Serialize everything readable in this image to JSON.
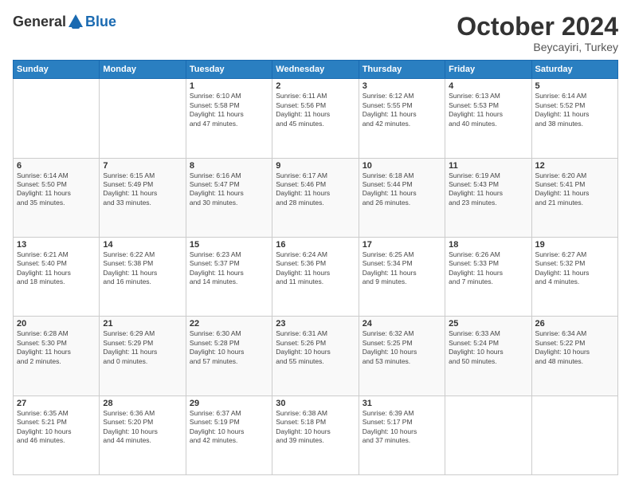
{
  "header": {
    "logo": {
      "line1": "General",
      "line2": "Blue"
    },
    "title": "October 2024",
    "location": "Beycayiri, Turkey"
  },
  "days_of_week": [
    "Sunday",
    "Monday",
    "Tuesday",
    "Wednesday",
    "Thursday",
    "Friday",
    "Saturday"
  ],
  "weeks": [
    {
      "row_class": "row-odd",
      "cells": [
        {
          "day": "",
          "info": ""
        },
        {
          "day": "",
          "info": ""
        },
        {
          "day": "1",
          "info": "Sunrise: 6:10 AM\nSunset: 5:58 PM\nDaylight: 11 hours\nand 47 minutes."
        },
        {
          "day": "2",
          "info": "Sunrise: 6:11 AM\nSunset: 5:56 PM\nDaylight: 11 hours\nand 45 minutes."
        },
        {
          "day": "3",
          "info": "Sunrise: 6:12 AM\nSunset: 5:55 PM\nDaylight: 11 hours\nand 42 minutes."
        },
        {
          "day": "4",
          "info": "Sunrise: 6:13 AM\nSunset: 5:53 PM\nDaylight: 11 hours\nand 40 minutes."
        },
        {
          "day": "5",
          "info": "Sunrise: 6:14 AM\nSunset: 5:52 PM\nDaylight: 11 hours\nand 38 minutes."
        }
      ]
    },
    {
      "row_class": "row-even",
      "cells": [
        {
          "day": "6",
          "info": "Sunrise: 6:14 AM\nSunset: 5:50 PM\nDaylight: 11 hours\nand 35 minutes."
        },
        {
          "day": "7",
          "info": "Sunrise: 6:15 AM\nSunset: 5:49 PM\nDaylight: 11 hours\nand 33 minutes."
        },
        {
          "day": "8",
          "info": "Sunrise: 6:16 AM\nSunset: 5:47 PM\nDaylight: 11 hours\nand 30 minutes."
        },
        {
          "day": "9",
          "info": "Sunrise: 6:17 AM\nSunset: 5:46 PM\nDaylight: 11 hours\nand 28 minutes."
        },
        {
          "day": "10",
          "info": "Sunrise: 6:18 AM\nSunset: 5:44 PM\nDaylight: 11 hours\nand 26 minutes."
        },
        {
          "day": "11",
          "info": "Sunrise: 6:19 AM\nSunset: 5:43 PM\nDaylight: 11 hours\nand 23 minutes."
        },
        {
          "day": "12",
          "info": "Sunrise: 6:20 AM\nSunset: 5:41 PM\nDaylight: 11 hours\nand 21 minutes."
        }
      ]
    },
    {
      "row_class": "row-odd",
      "cells": [
        {
          "day": "13",
          "info": "Sunrise: 6:21 AM\nSunset: 5:40 PM\nDaylight: 11 hours\nand 18 minutes."
        },
        {
          "day": "14",
          "info": "Sunrise: 6:22 AM\nSunset: 5:38 PM\nDaylight: 11 hours\nand 16 minutes."
        },
        {
          "day": "15",
          "info": "Sunrise: 6:23 AM\nSunset: 5:37 PM\nDaylight: 11 hours\nand 14 minutes."
        },
        {
          "day": "16",
          "info": "Sunrise: 6:24 AM\nSunset: 5:36 PM\nDaylight: 11 hours\nand 11 minutes."
        },
        {
          "day": "17",
          "info": "Sunrise: 6:25 AM\nSunset: 5:34 PM\nDaylight: 11 hours\nand 9 minutes."
        },
        {
          "day": "18",
          "info": "Sunrise: 6:26 AM\nSunset: 5:33 PM\nDaylight: 11 hours\nand 7 minutes."
        },
        {
          "day": "19",
          "info": "Sunrise: 6:27 AM\nSunset: 5:32 PM\nDaylight: 11 hours\nand 4 minutes."
        }
      ]
    },
    {
      "row_class": "row-even",
      "cells": [
        {
          "day": "20",
          "info": "Sunrise: 6:28 AM\nSunset: 5:30 PM\nDaylight: 11 hours\nand 2 minutes."
        },
        {
          "day": "21",
          "info": "Sunrise: 6:29 AM\nSunset: 5:29 PM\nDaylight: 11 hours\nand 0 minutes."
        },
        {
          "day": "22",
          "info": "Sunrise: 6:30 AM\nSunset: 5:28 PM\nDaylight: 10 hours\nand 57 minutes."
        },
        {
          "day": "23",
          "info": "Sunrise: 6:31 AM\nSunset: 5:26 PM\nDaylight: 10 hours\nand 55 minutes."
        },
        {
          "day": "24",
          "info": "Sunrise: 6:32 AM\nSunset: 5:25 PM\nDaylight: 10 hours\nand 53 minutes."
        },
        {
          "day": "25",
          "info": "Sunrise: 6:33 AM\nSunset: 5:24 PM\nDaylight: 10 hours\nand 50 minutes."
        },
        {
          "day": "26",
          "info": "Sunrise: 6:34 AM\nSunset: 5:22 PM\nDaylight: 10 hours\nand 48 minutes."
        }
      ]
    },
    {
      "row_class": "row-odd",
      "cells": [
        {
          "day": "27",
          "info": "Sunrise: 6:35 AM\nSunset: 5:21 PM\nDaylight: 10 hours\nand 46 minutes."
        },
        {
          "day": "28",
          "info": "Sunrise: 6:36 AM\nSunset: 5:20 PM\nDaylight: 10 hours\nand 44 minutes."
        },
        {
          "day": "29",
          "info": "Sunrise: 6:37 AM\nSunset: 5:19 PM\nDaylight: 10 hours\nand 42 minutes."
        },
        {
          "day": "30",
          "info": "Sunrise: 6:38 AM\nSunset: 5:18 PM\nDaylight: 10 hours\nand 39 minutes."
        },
        {
          "day": "31",
          "info": "Sunrise: 6:39 AM\nSunset: 5:17 PM\nDaylight: 10 hours\nand 37 minutes."
        },
        {
          "day": "",
          "info": ""
        },
        {
          "day": "",
          "info": ""
        }
      ]
    }
  ]
}
